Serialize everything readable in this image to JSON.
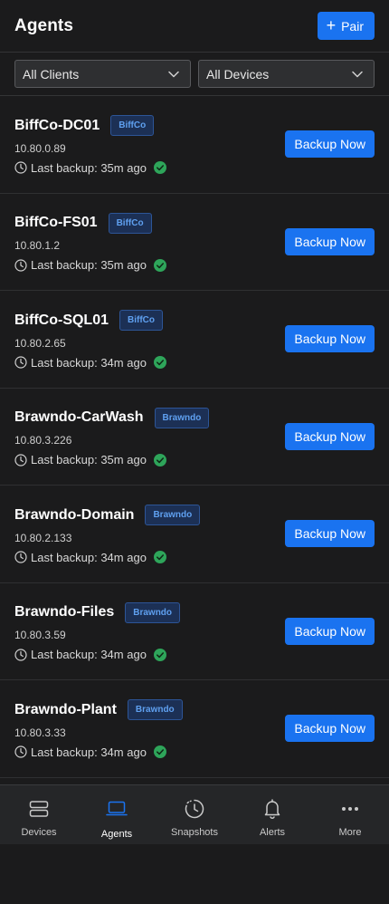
{
  "header": {
    "title": "Agents",
    "pair_label": "Pair"
  },
  "filters": {
    "clients": "All Clients",
    "devices": "All Devices"
  },
  "agents": [
    {
      "name": "BiffCo-DC01",
      "badge": "BiffCo",
      "ip": "10.80.0.89",
      "last_backup": "Last backup: 35m ago",
      "button": "Backup Now"
    },
    {
      "name": "BiffCo-FS01",
      "badge": "BiffCo",
      "ip": "10.80.1.2",
      "last_backup": "Last backup: 35m ago",
      "button": "Backup Now"
    },
    {
      "name": "BiffCo-SQL01",
      "badge": "BiffCo",
      "ip": "10.80.2.65",
      "last_backup": "Last backup: 34m ago",
      "button": "Backup Now"
    },
    {
      "name": "Brawndo-CarWash",
      "badge": "Brawndo",
      "ip": "10.80.3.226",
      "last_backup": "Last backup: 35m ago",
      "button": "Backup Now"
    },
    {
      "name": "Brawndo-Domain",
      "badge": "Brawndo",
      "ip": "10.80.2.133",
      "last_backup": "Last backup: 34m ago",
      "button": "Backup Now"
    },
    {
      "name": "Brawndo-Files",
      "badge": "Brawndo",
      "ip": "10.80.3.59",
      "last_backup": "Last backup: 34m ago",
      "button": "Backup Now"
    },
    {
      "name": "Brawndo-Plant",
      "badge": "Brawndo",
      "ip": "10.80.3.33",
      "last_backup": "Last backup: 34m ago",
      "button": "Backup Now"
    }
  ],
  "nav": [
    {
      "label": "Devices",
      "icon": "devices-icon"
    },
    {
      "label": "Agents",
      "icon": "laptop-icon"
    },
    {
      "label": "Snapshots",
      "icon": "snapshots-icon"
    },
    {
      "label": "Alerts",
      "icon": "bell-icon"
    },
    {
      "label": "More",
      "icon": "more-icon"
    }
  ],
  "colors": {
    "accent": "#1a73f0",
    "success": "#2ea55a",
    "badge_text": "#5fa0f0",
    "background": "#1b1b1c"
  }
}
